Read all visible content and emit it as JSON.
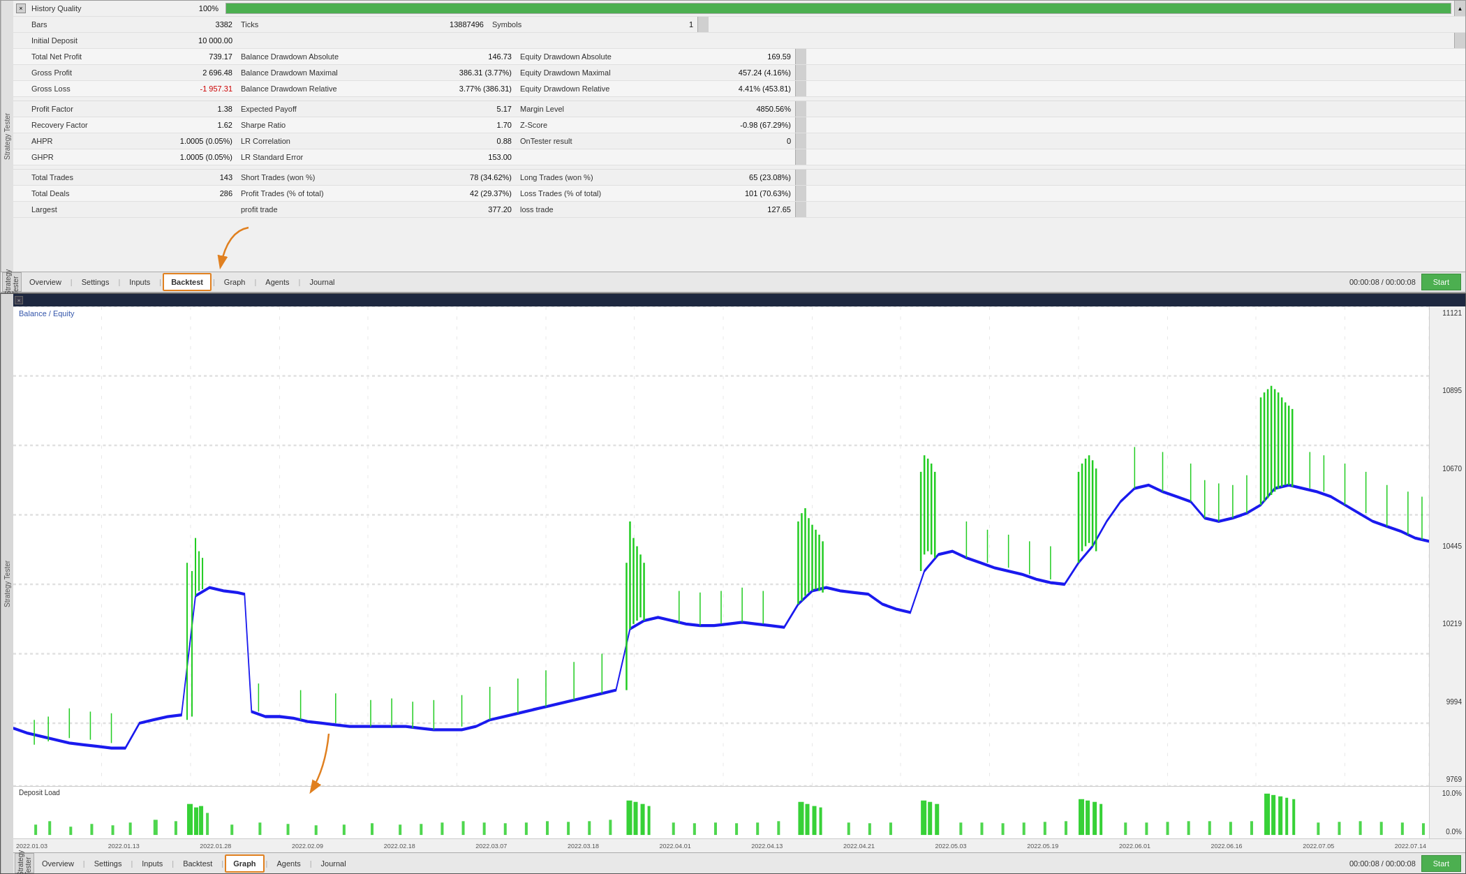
{
  "topPanel": {
    "title": "Strategy Tester",
    "closeBtn": "×",
    "historyQuality": {
      "label": "History Quality",
      "value": "100%",
      "progress": 100
    },
    "rows": [
      {
        "col1Label": "Bars",
        "col1Value": "3382",
        "col2Label": "Ticks",
        "col2Value": "13887496",
        "col3Label": "Symbols",
        "col3Value": "1"
      },
      {
        "col1Label": "Initial Deposit",
        "col1Value": "10 000.00",
        "col2Label": "",
        "col2Value": "",
        "col3Label": "",
        "col3Value": ""
      },
      {
        "col1Label": "Total Net Profit",
        "col1Value": "739.17",
        "col2Label": "Balance Drawdown Absolute",
        "col2Value": "146.73",
        "col3Label": "Equity Drawdown Absolute",
        "col3Value": "169.59"
      },
      {
        "col1Label": "Gross Profit",
        "col1Value": "2 696.48",
        "col2Label": "Balance Drawdown Maximal",
        "col2Value": "386.31 (3.77%)",
        "col3Label": "Equity Drawdown Maximal",
        "col3Value": "457.24 (4.16%)"
      },
      {
        "col1Label": "Gross Loss",
        "col1Value": "-1 957.31",
        "col2Label": "Balance Drawdown Relative",
        "col2Value": "3.77% (386.31)",
        "col3Label": "Equity Drawdown Relative",
        "col3Value": "4.41% (453.81)"
      },
      {
        "col1Label": "Profit Factor",
        "col1Value": "1.38",
        "col2Label": "Expected Payoff",
        "col2Value": "5.17",
        "col3Label": "Margin Level",
        "col3Value": "4850.56%"
      },
      {
        "col1Label": "Recovery Factor",
        "col1Value": "1.62",
        "col2Label": "Sharpe Ratio",
        "col2Value": "1.70",
        "col3Label": "Z-Score",
        "col3Value": "-0.98 (67.29%)"
      },
      {
        "col1Label": "AHPR",
        "col1Value": "1.0005 (0.05%)",
        "col2Label": "LR Correlation",
        "col2Value": "0.88",
        "col3Label": "OnTester result",
        "col3Value": "0"
      },
      {
        "col1Label": "GHPR",
        "col1Value": "1.0005 (0.05%)",
        "col2Label": "LR Standard Error",
        "col2Value": "153.00",
        "col3Label": "",
        "col3Value": ""
      },
      {
        "col1Label": "Total Trades",
        "col1Value": "143",
        "col2Label": "Short Trades (won %)",
        "col2Value": "78 (34.62%)",
        "col3Label": "Long Trades (won %)",
        "col3Value": "65 (23.08%)"
      },
      {
        "col1Label": "Total Deals",
        "col1Value": "286",
        "col2Label": "Profit Trades (% of total)",
        "col2Value": "42 (29.37%)",
        "col3Label": "Loss Trades (% of total)",
        "col3Value": "101 (70.63%)"
      },
      {
        "col1Label": "Largest",
        "col1Value": "",
        "col2Label": "profit trade",
        "col2Value": "377.20",
        "col3Label": "loss trade",
        "col3Value": "127.65"
      }
    ],
    "tabs": [
      {
        "label": "Overview",
        "active": false
      },
      {
        "label": "Settings",
        "active": false
      },
      {
        "label": "Inputs",
        "active": false
      },
      {
        "label": "Backtest",
        "active": true
      },
      {
        "label": "Graph",
        "active": false
      },
      {
        "label": "Agents",
        "active": false
      },
      {
        "label": "Journal",
        "active": false
      }
    ],
    "timeDisplay": "00:00:08 / 00:00:08",
    "startBtn": "Start"
  },
  "bottomPanel": {
    "chartLabel": "Balance / Equity",
    "depositLabel": "Deposit Load",
    "yAxisLabels": [
      "11121",
      "10895",
      "10670",
      "10445",
      "10219",
      "9994",
      "9769"
    ],
    "depositYLabels": [
      "10.0%",
      "0.0%"
    ],
    "xAxisLabels": [
      "2022.01.03",
      "2022.01.13",
      "2022.01.28",
      "2022.02.09",
      "2022.02.18",
      "2022.03.07",
      "2022.03.18",
      "2022.04.01",
      "2022.04.13",
      "2022.04.21",
      "2022.05.03",
      "2022.05.19",
      "2022.06.01",
      "2022.06.16",
      "2022.07.05",
      "2022.07.14"
    ],
    "tabs": [
      {
        "label": "Overview",
        "active": false
      },
      {
        "label": "Settings",
        "active": false
      },
      {
        "label": "Inputs",
        "active": false
      },
      {
        "label": "Backtest",
        "active": false
      },
      {
        "label": "Graph",
        "active": true
      },
      {
        "label": "Agents",
        "active": false
      },
      {
        "label": "Journal",
        "active": false
      }
    ],
    "timeDisplay": "00:00:08 / 00:00:08",
    "startBtn": "Start"
  },
  "colors": {
    "balanceLine": "#1a1aee",
    "equityLine": "#22cc22",
    "gridLine": "#d8d8d8",
    "background": "#ffffff",
    "chartBg": "#ffffff"
  }
}
